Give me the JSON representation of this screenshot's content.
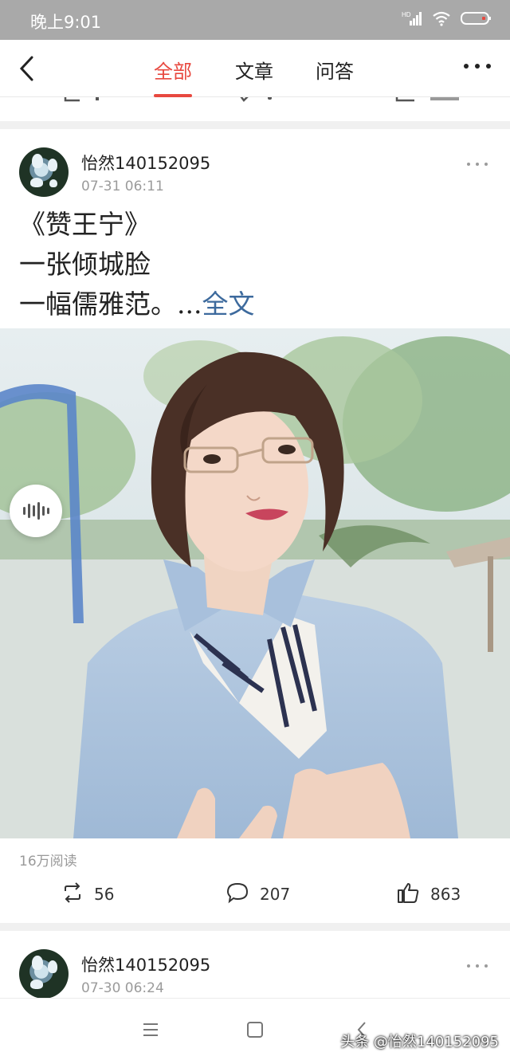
{
  "status_bar": {
    "time": "晚上9:01",
    "network": "HD"
  },
  "nav": {
    "back_icon": "chevron-left-icon",
    "tabs": [
      {
        "label": "全部",
        "active": true
      },
      {
        "label": "文章",
        "active": false
      },
      {
        "label": "问答",
        "active": false
      }
    ],
    "more_icon": "more-horizontal-icon",
    "accent_color": "#e8483f"
  },
  "posts": [
    {
      "username": "怡然140152095",
      "time": "07-31 06:11",
      "text_lines": [
        "《赞王宁》",
        "一张倾城脸",
        "一幅儒雅范。..."
      ],
      "more_link": "全文",
      "reads": "16万阅读",
      "reposts": "56",
      "comments": "207",
      "likes": "863"
    },
    {
      "username": "怡然140152095",
      "time": "07-30 06:24"
    }
  ],
  "watermark": "头条 @怡然140152095",
  "colors": {
    "link": "#3d6a9d",
    "muted": "#9b9b9b"
  }
}
